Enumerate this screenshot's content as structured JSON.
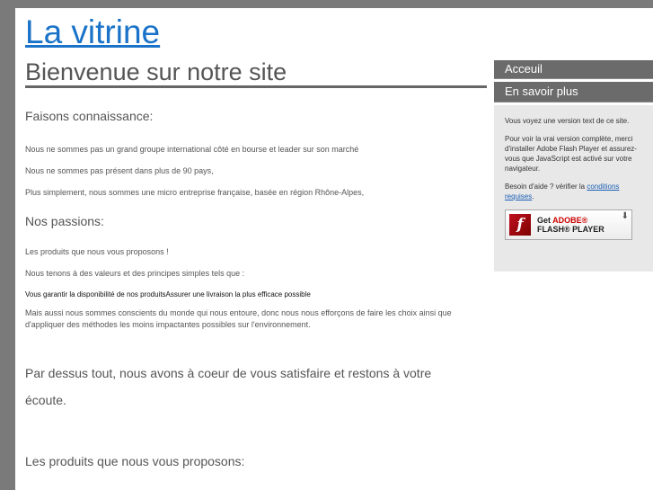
{
  "header": {
    "site_title": "La vitrine",
    "page_title": "Bienvenue sur notre site"
  },
  "content": {
    "heading_1": "Faisons connaissance:",
    "p1": "Nous ne sommes pas un grand groupe international côté en bourse et leader sur son marché",
    "p2": "Nous ne sommes pas présent dans plus de 90 pays,",
    "p3": "Plus simplement, nous sommes une micro entreprise française, basée en région Rhône-Alpes,",
    "heading_2": "Nos passions:",
    "p4": "Les produits que nous vous proposons !",
    "p5": "Nous tenons à des valeurs et des principes simples tels que :",
    "p6": "Vous garantir la disponibilité de nos produitsAssurer une livraison la plus efficace possible",
    "p7": "Mais aussi nous sommes conscients du monde qui nous entoure, donc nous nous efforçons de faire les choix ainsi que d'appliquer des méthodes les moins impactantes possibles sur l'environnement.",
    "p8_line1": "Par dessus tout, nous avons à coeur de vous satisfaire et restons à votre",
    "p8_line2": "écoute.",
    "p9": "Les produits que nous vous proposons:"
  },
  "sidebar": {
    "nav": [
      {
        "label": "Acceuil"
      },
      {
        "label": "En savoir plus"
      }
    ],
    "info": {
      "text1": "Vous voyez une version text de ce site.",
      "text2": "Pour voir la vrai version complète, merci d'installer Adobe Flash Player et assurez-vous que JavaScript est activé sur votre navigateur.",
      "text3_prefix": "Besoin d'aide ? vérifier la",
      "text3_link": "conditions requises",
      "text3_suffix": "."
    },
    "flash_badge": {
      "line1_prefix": "Get ",
      "line1_brand": "ADOBE®",
      "line2": "FLASH® PLAYER",
      "icon_glyph": "f",
      "download_glyph": "⬇"
    }
  }
}
